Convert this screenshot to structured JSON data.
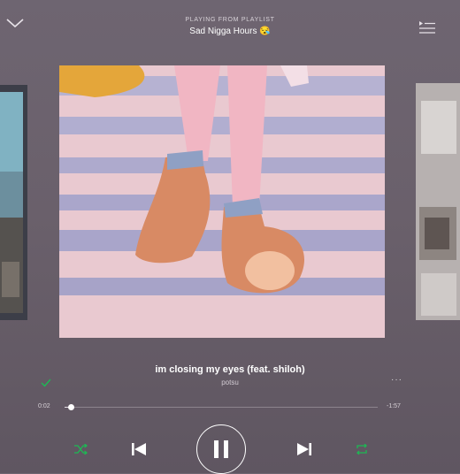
{
  "header": {
    "playing_from": "PLAYING FROM PLAYLIST",
    "playlist": "Sad Nigga Hours 😪"
  },
  "icons": {
    "collapse": "chevron-down-icon",
    "queue": "queue-list-icon",
    "like": "check-icon",
    "more": "more-icon",
    "shuffle": "shuffle-icon",
    "previous": "skip-previous-icon",
    "play_pause": "pause-icon",
    "next": "skip-next-icon",
    "repeat": "repeat-icon"
  },
  "track": {
    "title": "im closing my eyes (feat. shiloh)",
    "artist": "potsu",
    "more": "···"
  },
  "progress": {
    "elapsed": "0:02",
    "remaining": "-1:57",
    "fraction": 0.02
  },
  "colors": {
    "accent_green": "#1db954",
    "text": "#ffffff"
  }
}
